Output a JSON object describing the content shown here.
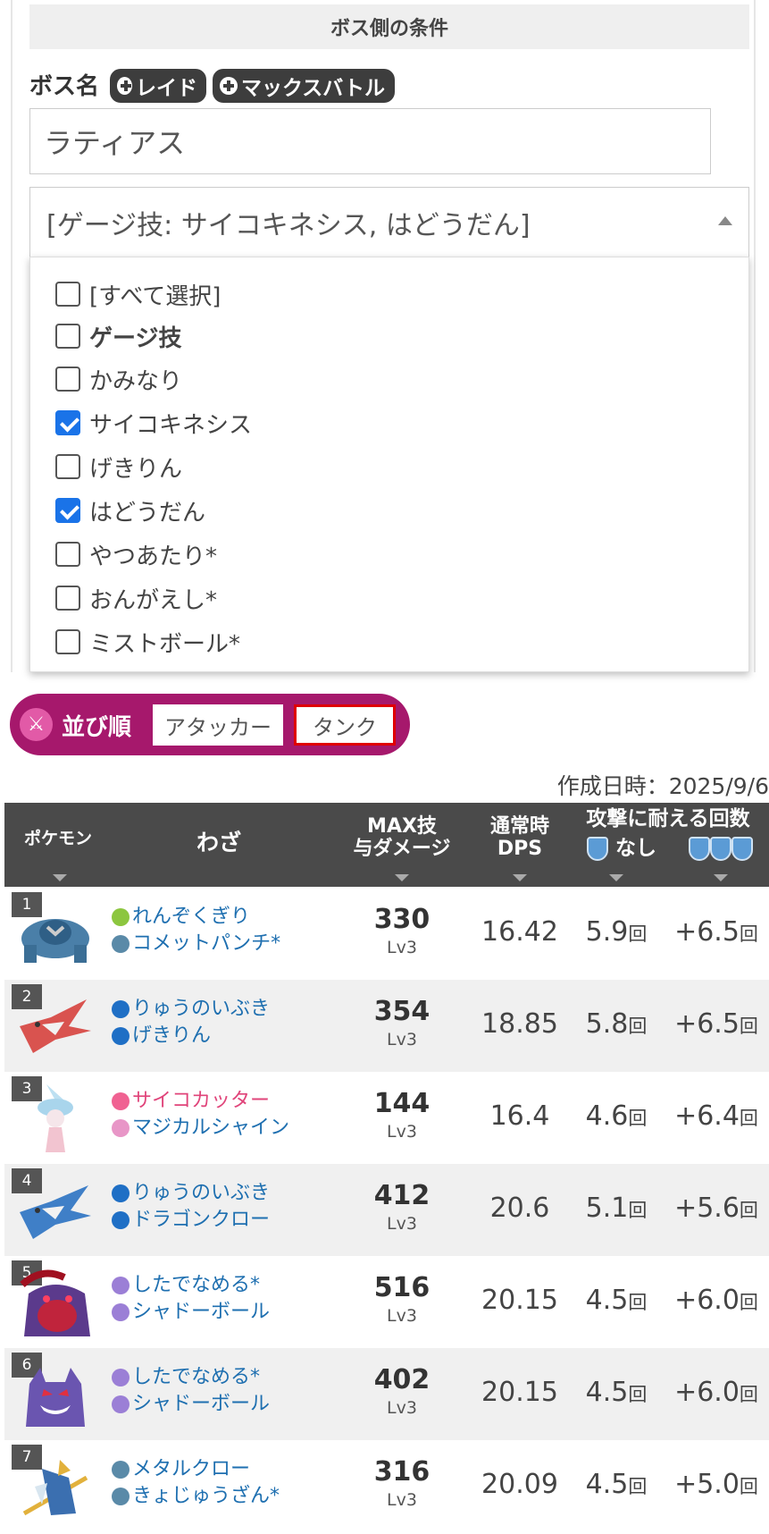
{
  "panel": {
    "header": "ボス側の条件",
    "boss_label": "ボス名",
    "raid_button": "レイド",
    "max_battle_button": "マックスバトル",
    "boss_name": "ラティアス",
    "moves_select_value": "[ゲージ技: サイコキネシス, はどうだん]",
    "options": [
      {
        "label": "[すべて選択]",
        "checked": false,
        "bold": false
      },
      {
        "label": "ゲージ技",
        "checked": false,
        "bold": true
      },
      {
        "label": "かみなり",
        "checked": false,
        "bold": false
      },
      {
        "label": "サイコキネシス",
        "checked": true,
        "bold": false
      },
      {
        "label": "げきりん",
        "checked": false,
        "bold": false
      },
      {
        "label": "はどうだん",
        "checked": true,
        "bold": false
      },
      {
        "label": "やつあたり*",
        "checked": false,
        "bold": false
      },
      {
        "label": "おんがえし*",
        "checked": false,
        "bold": false
      },
      {
        "label": "ミストボール*",
        "checked": false,
        "bold": false
      }
    ]
  },
  "sort": {
    "label": "並び順",
    "attacker": "アタッカー",
    "tank": "タンク",
    "selected": "タンク"
  },
  "created": "作成日時：2025/9/6",
  "table": {
    "headers": {
      "pokemon": "ポケモン",
      "moves": "わざ",
      "max_line1": "MAX技",
      "max_line2": "与ダメージ",
      "dps_line1": "通常時",
      "dps_line2": "DPS",
      "endure": "攻撃に耐える回数",
      "none": "なし"
    },
    "rows": [
      {
        "rank": "1",
        "pokemon_icon": "metagross-icon",
        "fast": "れんぞくぎり",
        "charged": "コメットパンチ*",
        "max": "330",
        "lv": "Lv3",
        "dps": "16.42",
        "hit1": "5.9",
        "hit3": "+6.5",
        "unit": "回"
      },
      {
        "rank": "2",
        "pokemon_icon": "latias-icon",
        "fast": "りゅうのいぶき",
        "charged": "げきりん",
        "max": "354",
        "lv": "Lv3",
        "dps": "18.85",
        "hit1": "5.8",
        "hit3": "+6.5",
        "unit": "回"
      },
      {
        "rank": "3",
        "pokemon_icon": "hatterene-icon",
        "fast": "サイコカッター",
        "charged": "マジカルシャイン",
        "max": "144",
        "lv": "Lv3",
        "dps": "16.4",
        "hit1": "4.6",
        "hit3": "+6.4",
        "unit": "回"
      },
      {
        "rank": "4",
        "pokemon_icon": "latios-icon",
        "fast": "りゅうのいぶき",
        "charged": "ドラゴンクロー",
        "max": "412",
        "lv": "Lv3",
        "dps": "20.6",
        "hit1": "5.1",
        "hit3": "+5.6",
        "unit": "回"
      },
      {
        "rank": "5",
        "pokemon_icon": "gigantamax-gengar-icon",
        "fast": "したでなめる*",
        "charged": "シャドーボール",
        "max": "516",
        "lv": "Lv3",
        "dps": "20.15",
        "hit1": "4.5",
        "hit3": "+6.0",
        "unit": "回"
      },
      {
        "rank": "6",
        "pokemon_icon": "gengar-icon",
        "fast": "したでなめる*",
        "charged": "シャドーボール",
        "max": "402",
        "lv": "Lv3",
        "dps": "20.15",
        "hit1": "4.5",
        "hit3": "+6.0",
        "unit": "回"
      },
      {
        "rank": "7",
        "pokemon_icon": "zacian-icon",
        "fast": "メタルクロー",
        "charged": "きょじゅうざん*",
        "max": "316",
        "lv": "Lv3",
        "dps": "20.09",
        "hit1": "4.5",
        "hit3": "+5.0",
        "unit": "回"
      }
    ]
  },
  "colors": {
    "sort_bar": "#a6186c",
    "tank_border": "#e00000",
    "header_bg": "#4a4a4a",
    "move_text": "#1e6fb0",
    "psychic_text": "#e0447a",
    "checkbox": "#1a73e8"
  }
}
